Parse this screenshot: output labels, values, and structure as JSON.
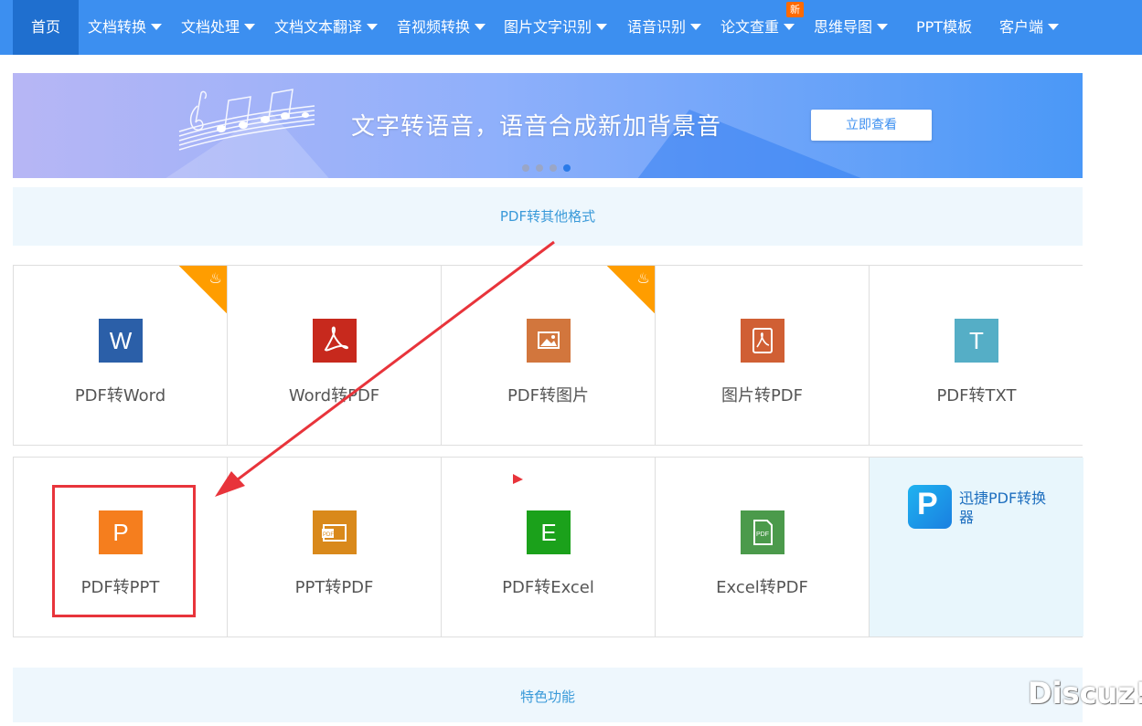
{
  "nav": {
    "items": [
      {
        "label": "首页",
        "caret": false
      },
      {
        "label": "文档转换",
        "caret": true
      },
      {
        "label": "文档处理",
        "caret": true
      },
      {
        "label": "文档文本翻译",
        "caret": true
      },
      {
        "label": "音视频转换",
        "caret": true
      },
      {
        "label": "图片文字识别",
        "caret": true
      },
      {
        "label": "语音识别",
        "caret": true
      },
      {
        "label": "论文查重",
        "caret": true
      },
      {
        "label": "思维导图",
        "caret": true
      },
      {
        "label": "PPT模板",
        "caret": false
      },
      {
        "label": "客户端",
        "caret": true
      }
    ],
    "new_badge": "新"
  },
  "banner": {
    "text": "文字转语音，语音合成新加背景音",
    "button": "立即查看",
    "dots": 4,
    "active_dot": 4
  },
  "section1": {
    "title": "PDF转其他格式"
  },
  "row1": [
    {
      "label": "PDF转Word",
      "glyph": "W",
      "color": "#2b5fa8",
      "hot": true
    },
    {
      "label": "Word转PDF",
      "glyph": "pdf",
      "color": "#c7291d",
      "hot": false
    },
    {
      "label": "PDF转图片",
      "glyph": "img",
      "color": "#d2763d",
      "hot": true
    },
    {
      "label": "图片转PDF",
      "glyph": "pdf",
      "color": "#d05f34",
      "hot": false
    },
    {
      "label": "PDF转TXT",
      "glyph": "T",
      "color": "#55aec6",
      "hot": false
    }
  ],
  "row2": [
    {
      "label": "PDF转PPT",
      "glyph": "P",
      "color": "#f57e1e"
    },
    {
      "label": "PPT转PDF",
      "glyph": "PDF",
      "color": "#d9891b"
    },
    {
      "label": "PDF转Excel",
      "glyph": "E",
      "color": "#1ba11b"
    },
    {
      "label": "Excel转PDF",
      "glyph": "PDF",
      "color": "#4b9a4b"
    }
  ],
  "promo": {
    "text": "迅捷PDF转换器",
    "logo": "P"
  },
  "section2": {
    "title": "特色功能"
  },
  "watermark": "Discuz!",
  "colors": {
    "nav": "#3c8ff0",
    "nav_active": "#1f6fcf",
    "section_bg": "#eef7fd",
    "section_text": "#3a9ad9",
    "highlight": "#e8343b"
  }
}
